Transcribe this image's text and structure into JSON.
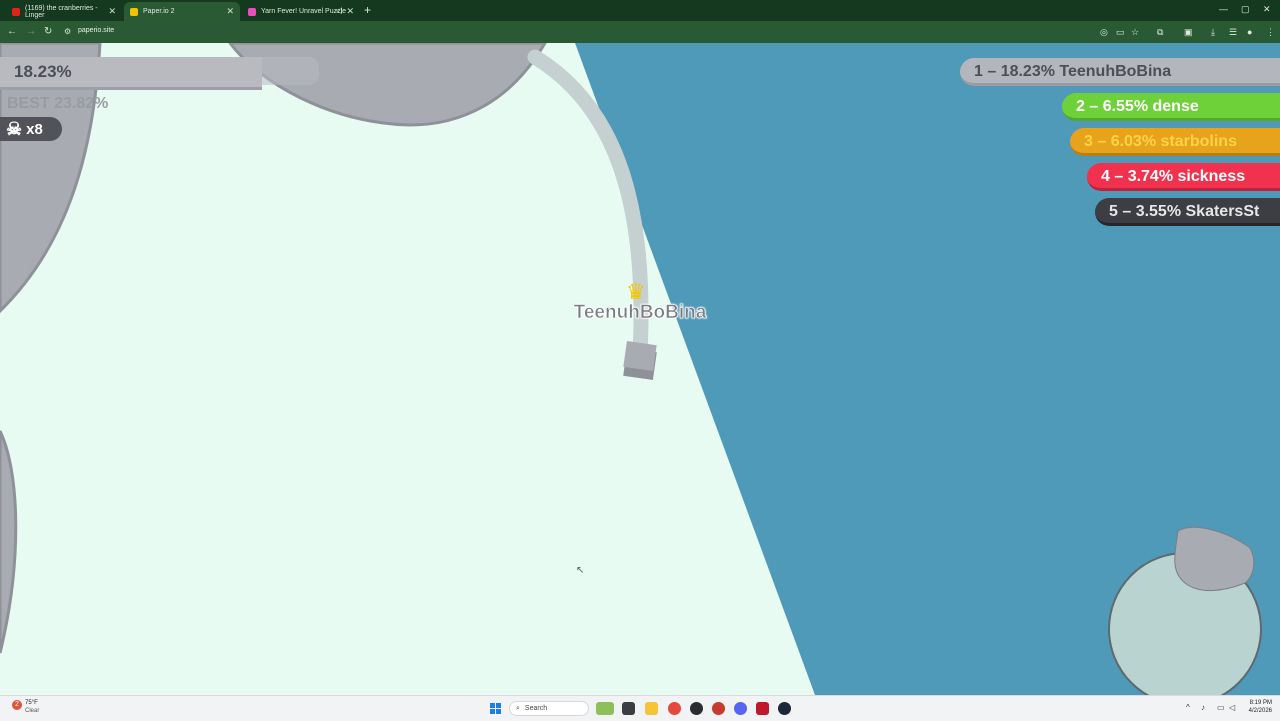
{
  "browser": {
    "tabs": [
      {
        "title": "(1169) the cranberries - Linger",
        "favicon_color": "#e62117",
        "active": false
      },
      {
        "title": "Paper.io 2",
        "favicon_color": "#f2c200",
        "active": true
      },
      {
        "title": "Yarn Fever! Unravel Puzzle",
        "favicon_color": "#e84fbf",
        "active": false
      }
    ],
    "url": "paperio.site"
  },
  "game": {
    "territory_percent": "18.23%",
    "best": "BEST 23.82%",
    "kills": "x8",
    "player_name": "TeenuhBoBina",
    "leaderboard": [
      {
        "label": "1 – 18.23% TeenuhBoBina",
        "color": "#b4b6bd",
        "text_color": "#4d4f56"
      },
      {
        "label": "2 – 6.55% dense",
        "color": "#6fd13a",
        "text_color": "#ffffff"
      },
      {
        "label": "3 – 6.03% starbolins",
        "color": "#e8a31c",
        "text_color": "#ffd24a"
      },
      {
        "label": "4 – 3.74% sickness",
        "color": "#f0324f",
        "text_color": "#ffffff"
      },
      {
        "label": "5 – 3.55% SkatersSt",
        "color": "#3c3e43",
        "text_color": "#e6e6e6"
      }
    ],
    "colors": {
      "player_territory": "#a9abb3",
      "trail": "#c5d1d0",
      "background_field": "#e8fbf3",
      "outside_area": "#4f9ab9"
    }
  },
  "taskbar": {
    "weather_temp": "75°F",
    "weather_desc": "Clear",
    "weather_badge": "2",
    "search_placeholder": "Search",
    "time": "8:19 PM",
    "date": "4/2/2026"
  }
}
